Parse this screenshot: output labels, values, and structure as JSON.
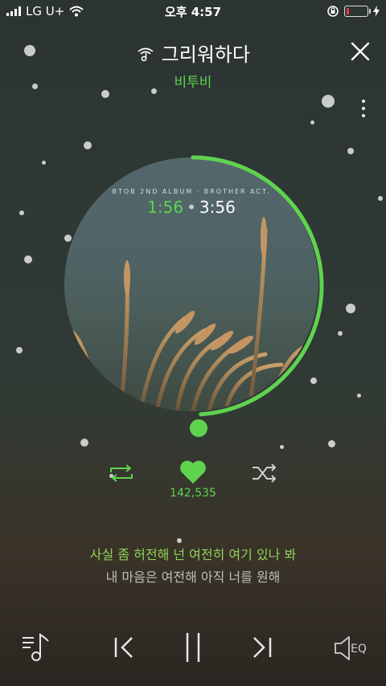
{
  "status_bar": {
    "carrier": "LG U+",
    "time": "오후 4:57"
  },
  "header": {
    "song_title": "그리워하다",
    "artist": "비투비"
  },
  "album": {
    "caption": "BTOB 2ND ALBUM · BROTHER ACT.",
    "current_time": "1:56",
    "separator": "•",
    "total_time": "3:56",
    "progress_fraction": 0.49
  },
  "controls": {
    "like_count": "142,535"
  },
  "lyrics": {
    "current_line": "사실 좀 허전해 넌 여전히 여기 있나 봐",
    "next_line": "내 마음은 여전해 아직 너를 원해"
  },
  "bottom_bar": {
    "eq_label": "EQ"
  },
  "colors": {
    "accent": "#5fd34f"
  }
}
